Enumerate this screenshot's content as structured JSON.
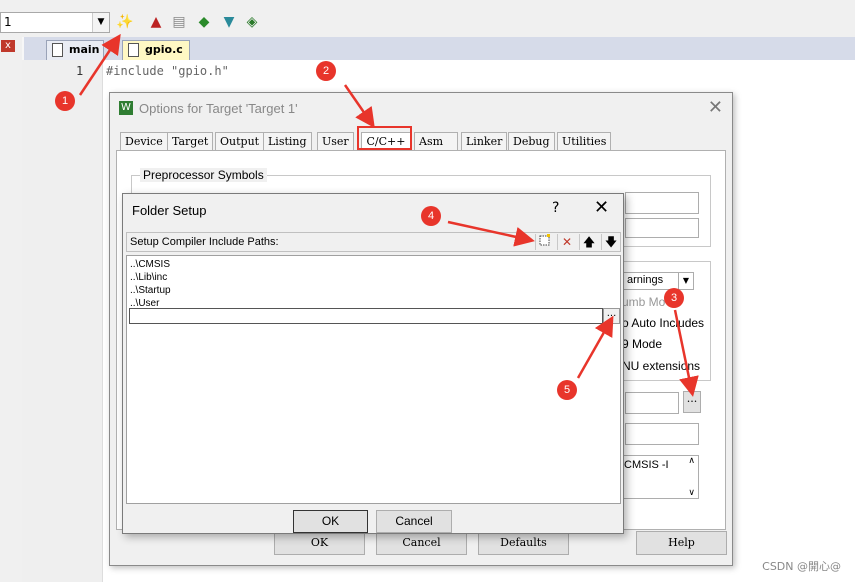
{
  "toolbar": {
    "target_value": "1",
    "icons": [
      "magic-wand-icon",
      "options-for-target-icon",
      "component-icon",
      "manage-icon",
      "diamond-icon",
      "filter-icon",
      "pack-installer-icon"
    ]
  },
  "editor": {
    "tabs": [
      {
        "label": "main"
      },
      {
        "label": "gpio.c",
        "active": true
      }
    ],
    "line_number": "1",
    "code_line": "#include \"gpio.h\""
  },
  "options_dialog": {
    "title": "Options for Target 'Target 1'",
    "tabs": [
      "Device",
      "Target",
      "Output",
      "Listing",
      "User",
      "C/C++",
      "Asm",
      "Linker",
      "Debug",
      "Utilities"
    ],
    "active_tab": "C/C++",
    "preprocessor_label": "Preprocessor Symbols",
    "warnings_value": "arnings",
    "thumb_mode_fragment": "umb Mo",
    "auto_includes_fragment": "o Auto Includes",
    "c99_fragment": "9 Mode",
    "gnu_fragment": "NU extensions",
    "misc_fragment": "CMSIS -I",
    "browse_label": "...",
    "buttons": {
      "ok": "OK",
      "cancel": "Cancel",
      "defaults": "Defaults",
      "help": "Help"
    }
  },
  "folder_setup": {
    "title": "Folder Setup",
    "help_glyph": "?",
    "close_glyph": "✕",
    "header_label": "Setup Compiler Include Paths:",
    "paths": [
      "..\\CMSIS",
      "..\\Lib\\inc",
      "..\\Startup",
      "..\\User"
    ],
    "new_path_value": "",
    "browse_label": "...",
    "ok_label": "OK",
    "cancel_label": "Cancel"
  },
  "annotations": {
    "color": "#e8352b",
    "badges": [
      "1",
      "2",
      "3",
      "4",
      "5"
    ]
  },
  "watermark": "CSDN @開心@"
}
